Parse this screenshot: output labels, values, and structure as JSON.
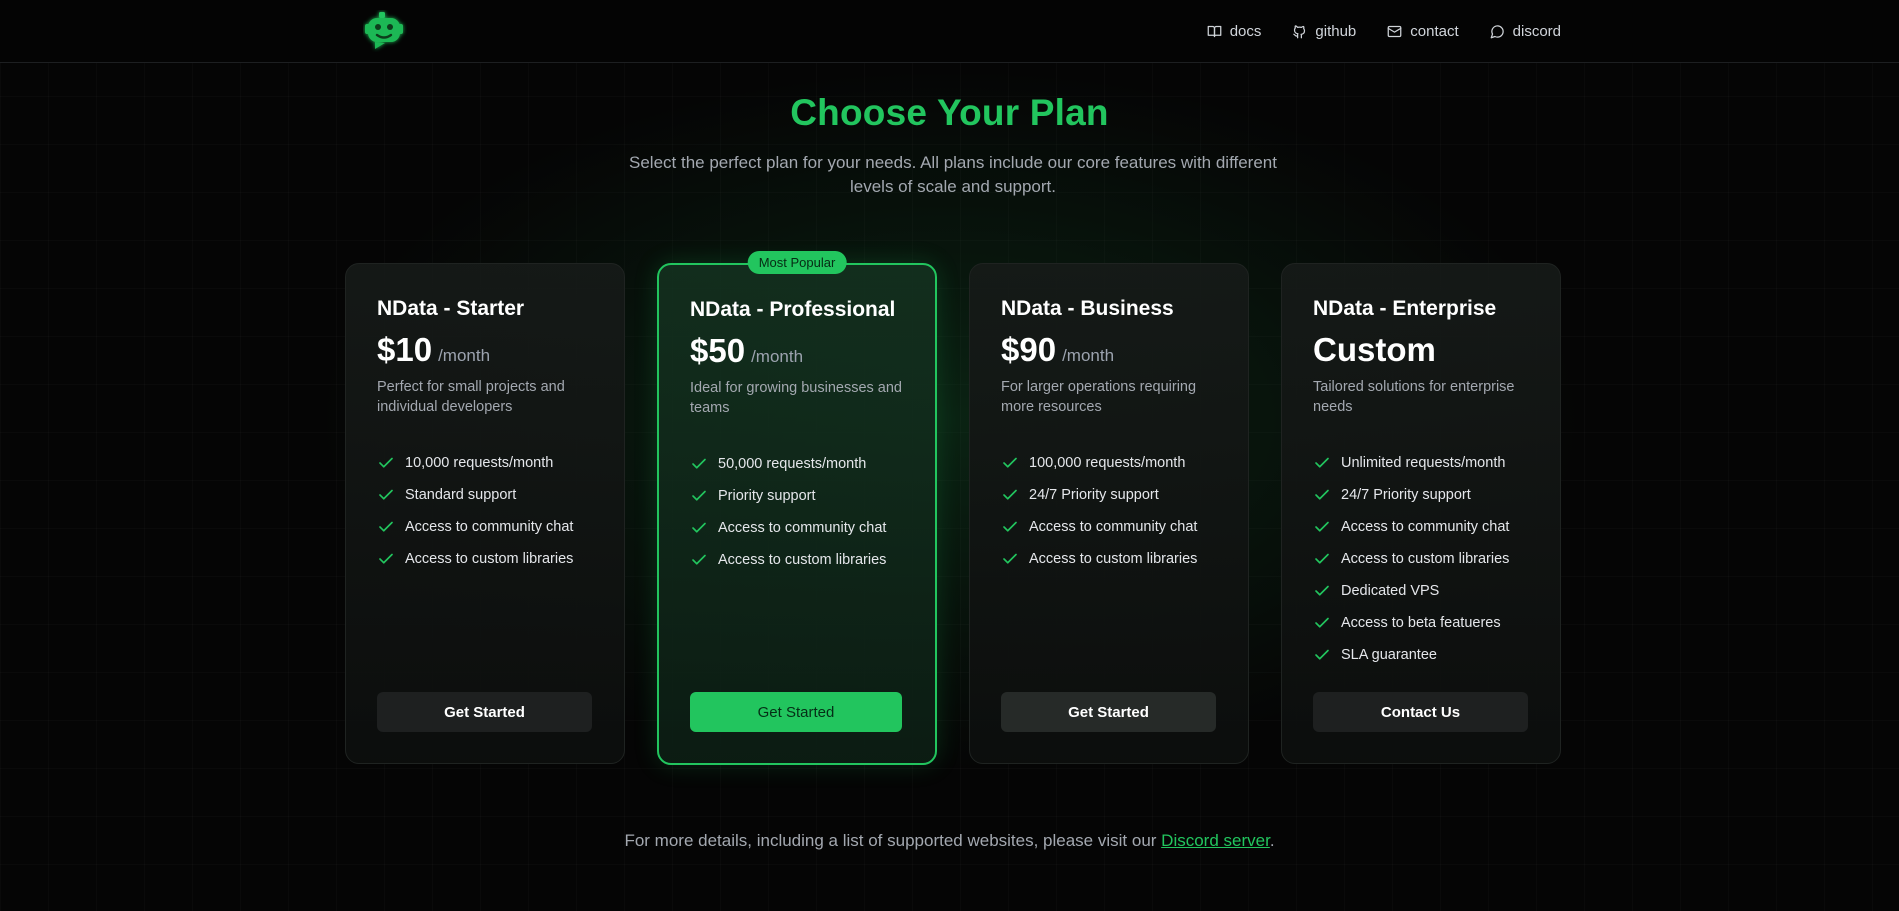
{
  "nav": {
    "items": [
      {
        "label": "docs",
        "icon": "book-icon"
      },
      {
        "label": "github",
        "icon": "github-icon"
      },
      {
        "label": "contact",
        "icon": "mail-icon"
      },
      {
        "label": "discord",
        "icon": "chat-bubble-icon"
      }
    ]
  },
  "hero": {
    "title": "Choose Your Plan",
    "subtitle": "Select the perfect plan for your needs. All plans include our core features with different levels of scale and support."
  },
  "plans": [
    {
      "name": "NData - Starter",
      "price": "$10",
      "period": "/month",
      "description": "Perfect for small projects and individual developers",
      "features": [
        "10,000 requests/month",
        "Standard support",
        "Access to community chat",
        "Access to custom libraries"
      ],
      "button": "Get Started"
    },
    {
      "name": "NData - Professional",
      "badge": "Most Popular",
      "price": "$50",
      "period": "/month",
      "description": "Ideal for growing businesses and teams",
      "features": [
        "50,000 requests/month",
        "Priority support",
        "Access to community chat",
        "Access to custom libraries"
      ],
      "button": "Get Started"
    },
    {
      "name": "NData - Business",
      "price": "$90",
      "period": "/month",
      "description": "For larger operations requiring more resources",
      "features": [
        "100,000 requests/month",
        "24/7 Priority support",
        "Access to community chat",
        "Access to custom libraries"
      ],
      "button": "Get Started"
    },
    {
      "name": "NData - Enterprise",
      "price": "Custom",
      "period": "",
      "description": "Tailored solutions for enterprise needs",
      "features": [
        "Unlimited requests/month",
        "24/7 Priority support",
        "Access to community chat",
        "Access to custom libraries",
        "Dedicated VPS",
        "Access to beta featueres",
        "SLA guarantee"
      ],
      "button": "Contact Us"
    }
  ],
  "footer": {
    "text_before": "For more details, including a list of supported websites, please visit our ",
    "link": "Discord server",
    "text_after": "."
  },
  "colors": {
    "accent": "#22c55e",
    "background": "#050505",
    "card": "#121413",
    "button": "#1e2020"
  }
}
